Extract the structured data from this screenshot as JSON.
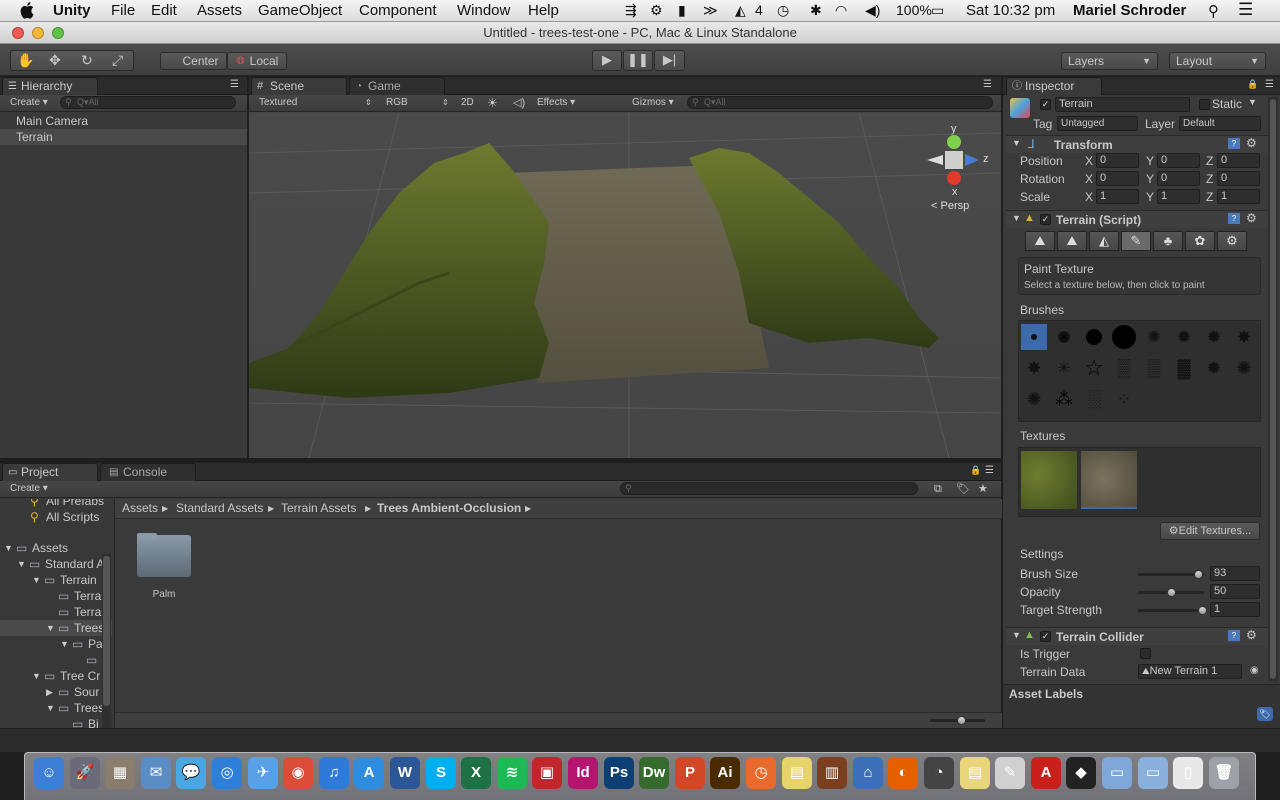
{
  "menubar": {
    "app": "Unity",
    "items": [
      "File",
      "Edit",
      "Assets",
      "GameObject",
      "Component",
      "Window",
      "Help"
    ],
    "battery": "100%",
    "adobe_badge": "4",
    "clock": "Sat 10:32 pm",
    "user": "Mariel Schroder"
  },
  "window": {
    "title": "Untitled - trees-test-one - PC, Mac & Linux Standalone"
  },
  "toolbar": {
    "pivot": "Center",
    "space": "Local",
    "layers": "Layers",
    "layout": "Layout"
  },
  "hierarchy": {
    "tab": "Hierarchy",
    "create": "Create",
    "search": "Q▾All",
    "items": [
      {
        "label": "Main Camera",
        "selected": false
      },
      {
        "label": "Terrain",
        "selected": true
      }
    ]
  },
  "scene": {
    "tabs": [
      "Scene",
      "Game"
    ],
    "render_mode": "Textured",
    "color_mode": "RGB",
    "mode_2d": "2D",
    "effects": "Effects",
    "gizmos": "Gizmos",
    "search": "Q▾All",
    "gizmo_label": "Persp",
    "axis_labels": {
      "y": "y",
      "z": "z",
      "x": "x"
    }
  },
  "inspector": {
    "tab": "Inspector",
    "object_name": "Terrain",
    "static_label": "Static",
    "tag_label": "Tag",
    "tag_value": "Untagged",
    "layer_label": "Layer",
    "layer_value": "Default",
    "transform": {
      "title": "Transform",
      "rows": [
        {
          "label": "Position",
          "x": "0",
          "y": "0",
          "z": "0"
        },
        {
          "label": "Rotation",
          "x": "0",
          "y": "0",
          "z": "0"
        },
        {
          "label": "Scale",
          "x": "1",
          "y": "1",
          "z": "1"
        }
      ],
      "axis": {
        "x": "X",
        "y": "Y",
        "z": "Z"
      }
    },
    "terrain_script": {
      "title": "Terrain (Script)",
      "tool_title": "Paint Texture",
      "tool_hint": "Select a texture below, then click to paint",
      "brushes_label": "Brushes",
      "textures_label": "Textures",
      "edit_textures": "Edit Textures...",
      "settings_label": "Settings",
      "settings": [
        {
          "label": "Brush Size",
          "value": "93",
          "level": 0.93
        },
        {
          "label": "Opacity",
          "value": "50",
          "level": 0.5
        },
        {
          "label": "Target Strength",
          "value": "1",
          "level": 1.0
        }
      ]
    },
    "terrain_collider": {
      "title": "Terrain Collider",
      "is_trigger_label": "Is Trigger",
      "terrain_data_label": "Terrain Data",
      "terrain_data_value": "New Terrain 1"
    },
    "asset_labels": "Asset Labels"
  },
  "project": {
    "tabs": [
      "Project",
      "Console"
    ],
    "create": "Create",
    "favorites": [
      "All Prefabs",
      "All Scripts"
    ],
    "tree": [
      {
        "label": "Assets",
        "depth": 0
      },
      {
        "label": "Standard A",
        "depth": 1
      },
      {
        "label": "Terrain",
        "depth": 2
      },
      {
        "label": "Terra",
        "depth": 3
      },
      {
        "label": "Terra",
        "depth": 3
      },
      {
        "label": "Trees",
        "depth": 3,
        "selected": true
      },
      {
        "label": "Pa",
        "depth": 4
      },
      {
        "label": "",
        "depth": 5
      },
      {
        "label": "Tree Cr",
        "depth": 2
      },
      {
        "label": "Sour",
        "depth": 3
      },
      {
        "label": "Trees",
        "depth": 3
      },
      {
        "label": "Bi",
        "depth": 4
      }
    ],
    "breadcrumb": [
      "Assets",
      "Standard Assets",
      "Terrain Assets",
      "Trees Ambient-Occlusion"
    ],
    "folders": [
      "Palm"
    ]
  },
  "dock": {
    "apps": [
      {
        "name": "finder",
        "color": "#3b7fd6",
        "glyph": "☺"
      },
      {
        "name": "launchpad",
        "color": "#6a6a78",
        "glyph": "🚀"
      },
      {
        "name": "photos",
        "color": "#8a7d6b",
        "glyph": "▦"
      },
      {
        "name": "preview",
        "color": "#5b8cc4",
        "glyph": "✉"
      },
      {
        "name": "messages",
        "color": "#4aa8e0",
        "glyph": "💬"
      },
      {
        "name": "safari",
        "color": "#2f7fd8",
        "glyph": "◎"
      },
      {
        "name": "mail",
        "color": "#5aa0e6",
        "glyph": "✈"
      },
      {
        "name": "chrome",
        "color": "#dd4b39",
        "glyph": "◉"
      },
      {
        "name": "itunes",
        "color": "#2f7ad8",
        "glyph": "♫"
      },
      {
        "name": "app-store",
        "color": "#2f8de0",
        "glyph": "A"
      },
      {
        "name": "word",
        "color": "#2b5797",
        "glyph": "W"
      },
      {
        "name": "skype",
        "color": "#00aff0",
        "glyph": "S"
      },
      {
        "name": "excel",
        "color": "#1e7145",
        "glyph": "X"
      },
      {
        "name": "spotify",
        "color": "#1db954",
        "glyph": "≋"
      },
      {
        "name": "flash",
        "color": "#c0262c",
        "glyph": "▣"
      },
      {
        "name": "indesign",
        "color": "#b5156e",
        "glyph": "Id"
      },
      {
        "name": "photoshop",
        "color": "#0d3f75",
        "glyph": "Ps"
      },
      {
        "name": "dreamweaver",
        "color": "#356b2d",
        "glyph": "Dw"
      },
      {
        "name": "powerpoint",
        "color": "#d24726",
        "glyph": "P"
      },
      {
        "name": "illustrator",
        "color": "#4a2a00",
        "glyph": "Ai"
      },
      {
        "name": "ical",
        "color": "#e86a2c",
        "glyph": "◷"
      },
      {
        "name": "stickies",
        "color": "#e6d36a",
        "glyph": "▤"
      },
      {
        "name": "notebook",
        "color": "#7a3f1e",
        "glyph": "▥"
      },
      {
        "name": "keynote",
        "color": "#3b6fb8",
        "glyph": "⌂"
      },
      {
        "name": "firefox",
        "color": "#e66000",
        "glyph": "◐"
      },
      {
        "name": "dashboard",
        "color": "#444",
        "glyph": "◔"
      },
      {
        "name": "notes",
        "color": "#e9d67a",
        "glyph": "▤"
      },
      {
        "name": "textedit",
        "color": "#d0d0d0",
        "glyph": "✎"
      },
      {
        "name": "acrobat",
        "color": "#c9201c",
        "glyph": "A"
      },
      {
        "name": "unity",
        "color": "#222",
        "glyph": "◆"
      },
      {
        "name": "applications-folder",
        "color": "#7fa8d8",
        "glyph": "▭"
      },
      {
        "name": "documents-folder",
        "color": "#8ab0dc",
        "glyph": "▭"
      },
      {
        "name": "file",
        "color": "#e8e8e8",
        "glyph": "▯"
      },
      {
        "name": "trash",
        "color": "#9ea2a8",
        "glyph": "🗑"
      }
    ]
  }
}
